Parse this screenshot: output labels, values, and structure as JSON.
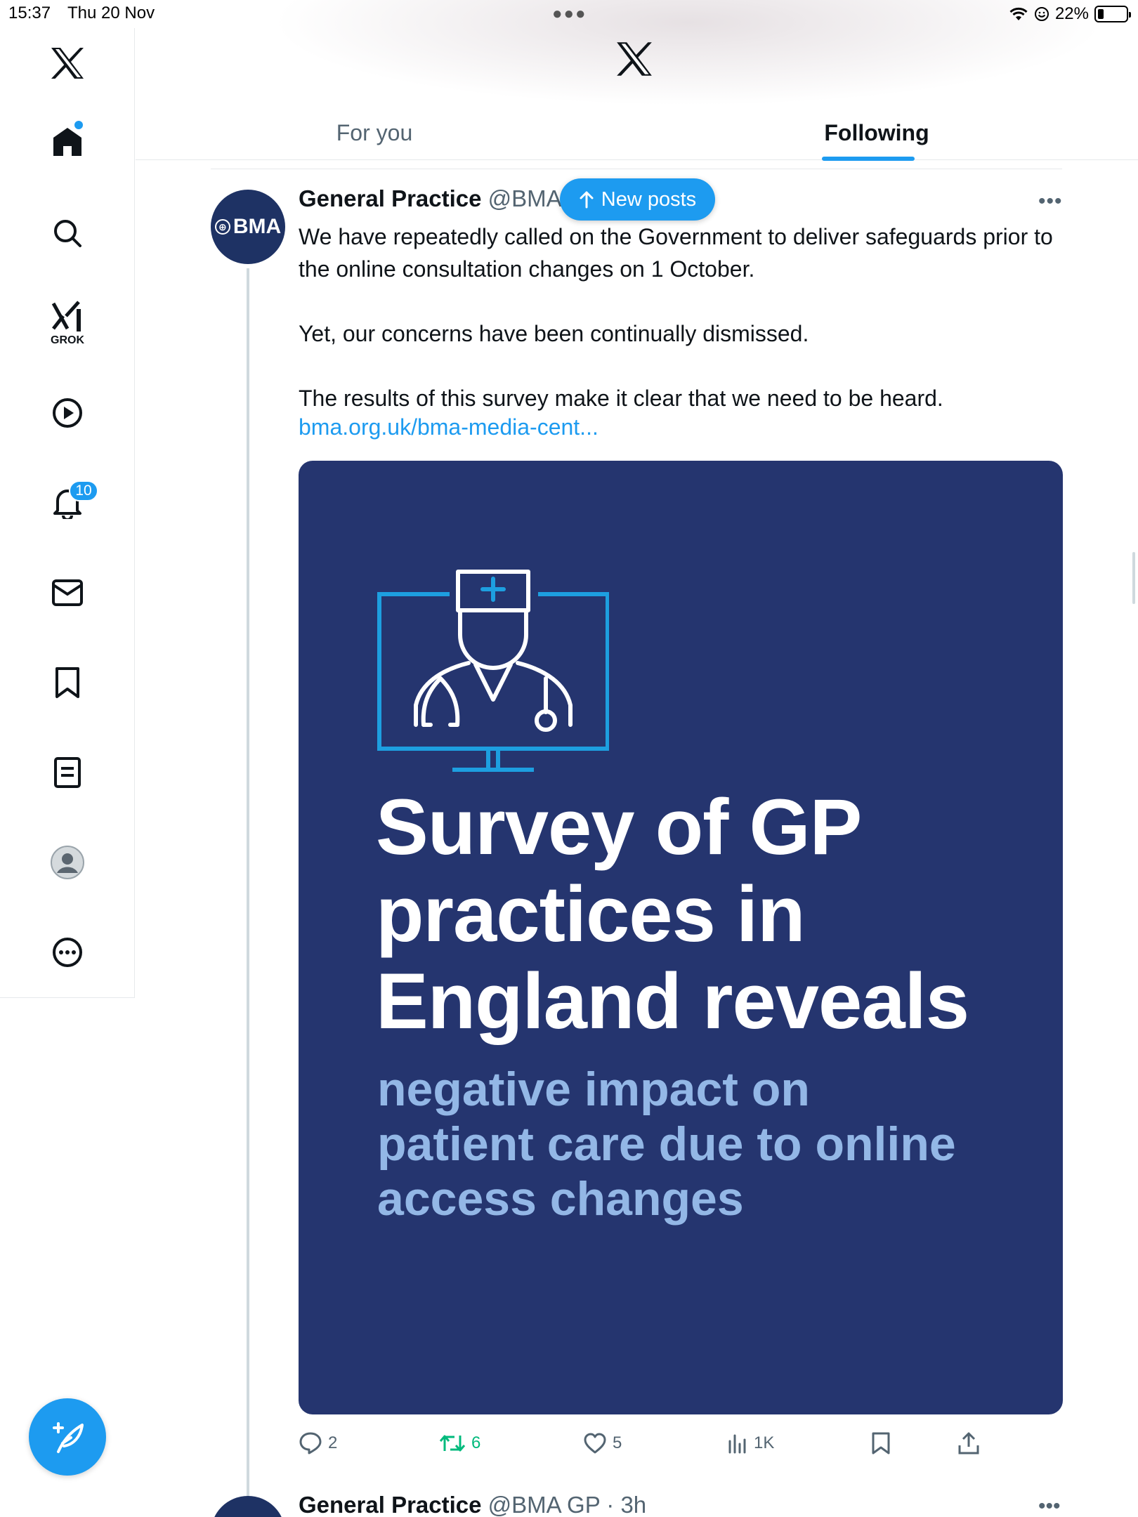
{
  "status_bar": {
    "time": "15:37",
    "date": "Thu 20 Nov",
    "battery": "22%",
    "battery_level": 0.22
  },
  "sidebar": {
    "items": [
      {
        "id": "home",
        "label": "Home",
        "icon": "home-icon",
        "has_dot": true
      },
      {
        "id": "explore",
        "label": "Explore",
        "icon": "search-icon"
      },
      {
        "id": "grok",
        "label": "GROK",
        "icon": "grok-icon"
      },
      {
        "id": "videos",
        "label": "Videos",
        "icon": "play-icon"
      },
      {
        "id": "notifications",
        "label": "Notifications",
        "icon": "bell-icon",
        "badge": "10"
      },
      {
        "id": "messages",
        "label": "Messages",
        "icon": "mail-icon"
      },
      {
        "id": "bookmarks",
        "label": "Bookmarks",
        "icon": "bookmark-icon"
      },
      {
        "id": "articles",
        "label": "Articles",
        "icon": "document-icon"
      },
      {
        "id": "profile",
        "label": "Profile",
        "icon": "avatar-icon"
      },
      {
        "id": "more",
        "label": "More",
        "icon": "more-circle-icon"
      }
    ],
    "grok_label": "GROK",
    "notification_badge": "10",
    "compose_icon": "compose-feather-icon"
  },
  "header": {
    "logo_icon": "x-logo-icon",
    "tabs": [
      {
        "label": "For you",
        "active": false
      },
      {
        "label": "Following",
        "active": true
      }
    ]
  },
  "new_posts_pill": {
    "label": "New posts",
    "icon": "arrow-up-icon"
  },
  "post": {
    "avatar_text": "BMA",
    "author_name": "General Practice",
    "author_handle": "@BMA",
    "paragraphs": [
      "We have repeatedly called on the Government to deliver safeguards prior to the online consultation changes on 1 October.",
      "Yet, our concerns have been continually dismissed.",
      "The results of this survey make it clear that we need to be heard."
    ],
    "link": "bma.org.uk/bma-media-cent...",
    "media": {
      "title_lines": [
        "Survey of GP",
        "practices in",
        "England reveals"
      ],
      "subtitle_lines": [
        "negative impact on",
        "patient care due to online",
        "access changes"
      ],
      "bg_color": "#25356f",
      "accent_color": "#1d9fe0",
      "subtitle_color": "#93b7e6"
    },
    "actions": {
      "replies": "2",
      "reposts": "6",
      "likes": "5",
      "views": "1K"
    },
    "repost_color": "#00ba7c"
  },
  "next_post": {
    "author_name": "General Practice",
    "author_handle_time": "@BMA GP · 3h"
  },
  "colors": {
    "accent": "#1d9bf0",
    "text": "#0f1419",
    "muted": "#536471"
  }
}
